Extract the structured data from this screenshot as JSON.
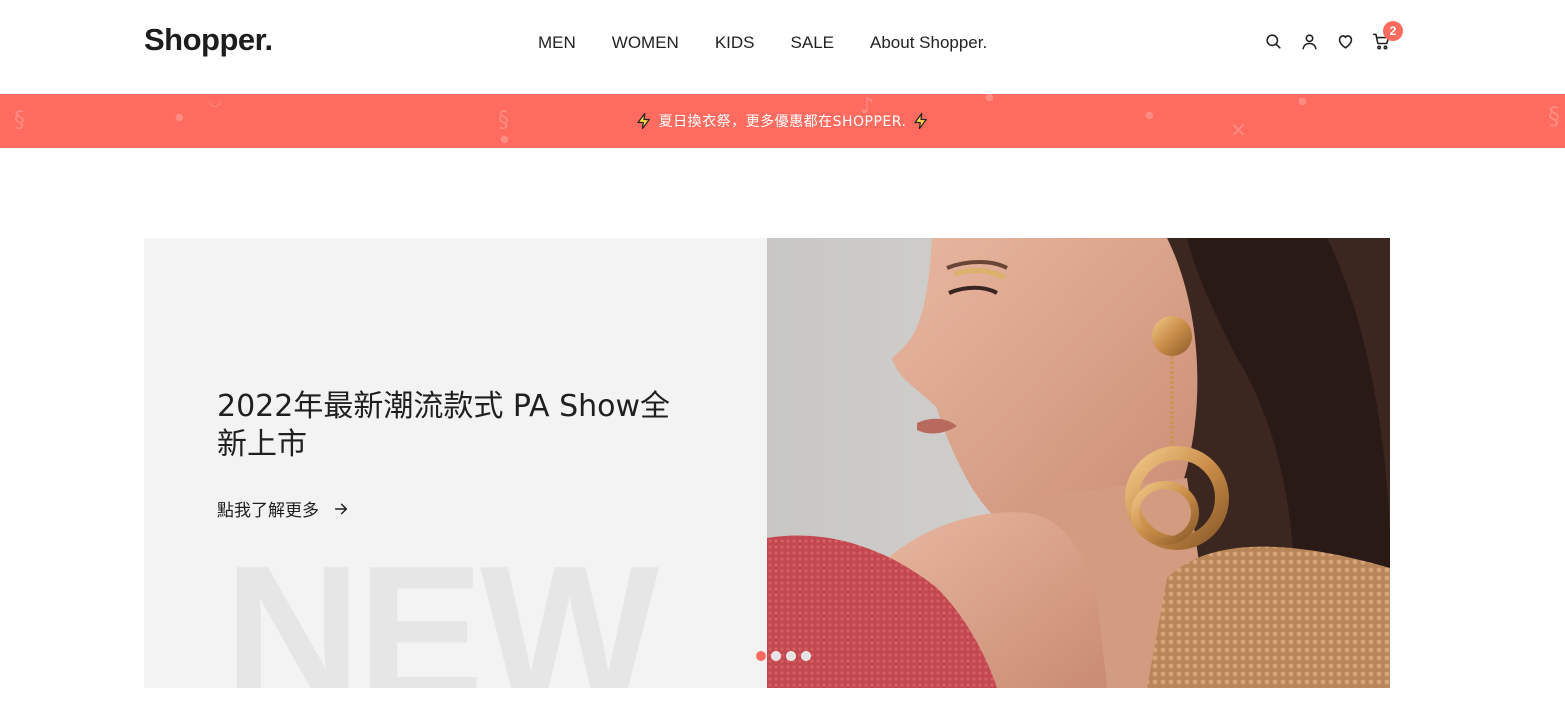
{
  "brand": {
    "logo": "Shopper.",
    "accent": "#ff6b5e"
  },
  "nav": [
    {
      "label": "MEN"
    },
    {
      "label": "WOMEN"
    },
    {
      "label": "KIDS"
    },
    {
      "label": "SALE"
    },
    {
      "label": "About Shopper."
    }
  ],
  "header_icons": [
    "search-icon",
    "user-icon",
    "heart-icon",
    "cart-icon"
  ],
  "cart": {
    "count": "2"
  },
  "promo": {
    "text": "夏日換衣祭，更多優惠都在SHOPPER.",
    "background": "#ff6b5f"
  },
  "hero": {
    "title": "2022年最新潮流款式 PA Show全新上市",
    "link_label": "點我了解更多",
    "watermark": "NEW",
    "slides": 4,
    "active_slide": 1
  }
}
